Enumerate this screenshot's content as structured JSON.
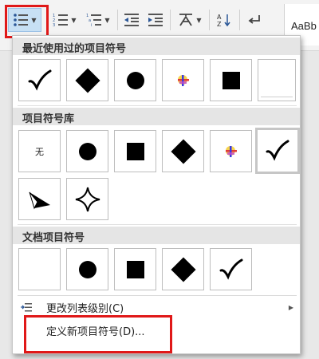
{
  "toolbar": {
    "style_preview": "AaBb"
  },
  "panel": {
    "recent_title": "最近使用过的项目符号",
    "library_title": "项目符号库",
    "library_none_label": "无",
    "document_title": "文档项目符号",
    "change_level_label": "更改列表级别(C)",
    "define_new_label": "定义新项目符号(D)..."
  },
  "colors": {
    "highlight_frame": "#e01818",
    "active_button": "#c7e0f4",
    "section_header": "#e5e5e5"
  },
  "icons": [
    "bullets-icon",
    "numbering-icon",
    "multilevel-list-icon",
    "decrease-indent-icon",
    "increase-indent-icon",
    "chinese-layout-icon",
    "sort-icon",
    "paragraph-mark-icon",
    "checkmark-icon",
    "diamond-icon",
    "circle-icon",
    "square-icon",
    "arrowhead-icon",
    "four-point-star-icon",
    "picture-bullet-icon"
  ]
}
